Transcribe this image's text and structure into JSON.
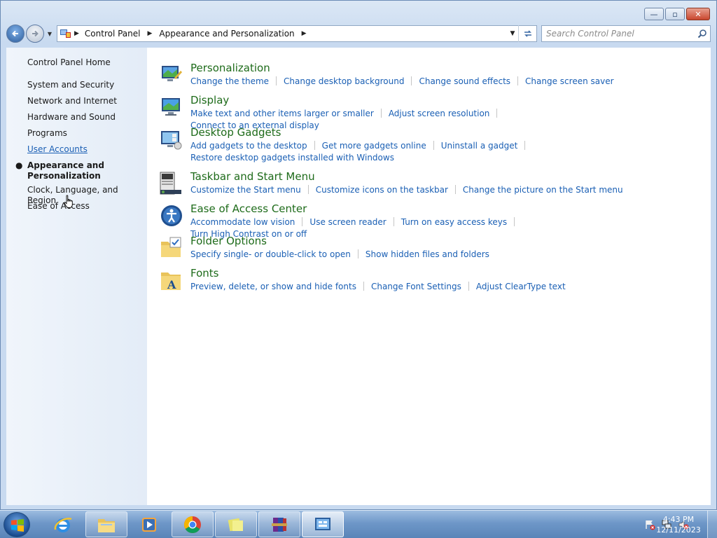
{
  "window": {
    "caption": {
      "minimize": "—",
      "maximize": "▫",
      "close": "✕"
    }
  },
  "address": {
    "breadcrumb": [
      "Control Panel",
      "Appearance and Personalization"
    ],
    "search_placeholder": "Search Control Panel"
  },
  "sidebar": {
    "home": "Control Panel Home",
    "items": [
      {
        "label": "System and Security"
      },
      {
        "label": "Network and Internet"
      },
      {
        "label": "Hardware and Sound"
      },
      {
        "label": "Programs"
      },
      {
        "label": "User Accounts"
      },
      {
        "label": "Appearance and Personalization"
      },
      {
        "label": "Clock, Language, and Region"
      },
      {
        "label": "Ease of Access"
      }
    ]
  },
  "categories": [
    {
      "title": "Personalization",
      "icon": "personalization-icon",
      "links": [
        "Change the theme",
        "Change desktop background",
        "Change sound effects",
        "Change screen saver"
      ]
    },
    {
      "title": "Display",
      "icon": "display-icon",
      "links": [
        "Make text and other items larger or smaller",
        "Adjust screen resolution",
        "Connect to an external display"
      ]
    },
    {
      "title": "Desktop Gadgets",
      "icon": "gadgets-icon",
      "links": [
        "Add gadgets to the desktop",
        "Get more gadgets online",
        "Uninstall a gadget",
        "Restore desktop gadgets installed with Windows"
      ]
    },
    {
      "title": "Taskbar and Start Menu",
      "icon": "taskbar-icon",
      "links": [
        "Customize the Start menu",
        "Customize icons on the taskbar",
        "Change the picture on the Start menu"
      ]
    },
    {
      "title": "Ease of Access Center",
      "icon": "ease-of-access-icon",
      "links": [
        "Accommodate low vision",
        "Use screen reader",
        "Turn on easy access keys",
        "Turn High Contrast on or off"
      ]
    },
    {
      "title": "Folder Options",
      "icon": "folder-options-icon",
      "links": [
        "Specify single- or double-click to open",
        "Show hidden files and folders"
      ]
    },
    {
      "title": "Fonts",
      "icon": "fonts-icon",
      "links": [
        "Preview, delete, or show and hide fonts",
        "Change Font Settings",
        "Adjust ClearType text"
      ]
    }
  ],
  "taskbar": {
    "pinned": [
      "internet-explorer-icon",
      "file-explorer-icon",
      "media-player-icon",
      "chrome-icon",
      "sticky-notes-icon",
      "winrar-icon",
      "control-panel-icon"
    ],
    "time": "4:43 PM",
    "date": "12/11/2023"
  },
  "colors": {
    "link": "#1a5fb4",
    "category_title": "#1e6b1a"
  }
}
